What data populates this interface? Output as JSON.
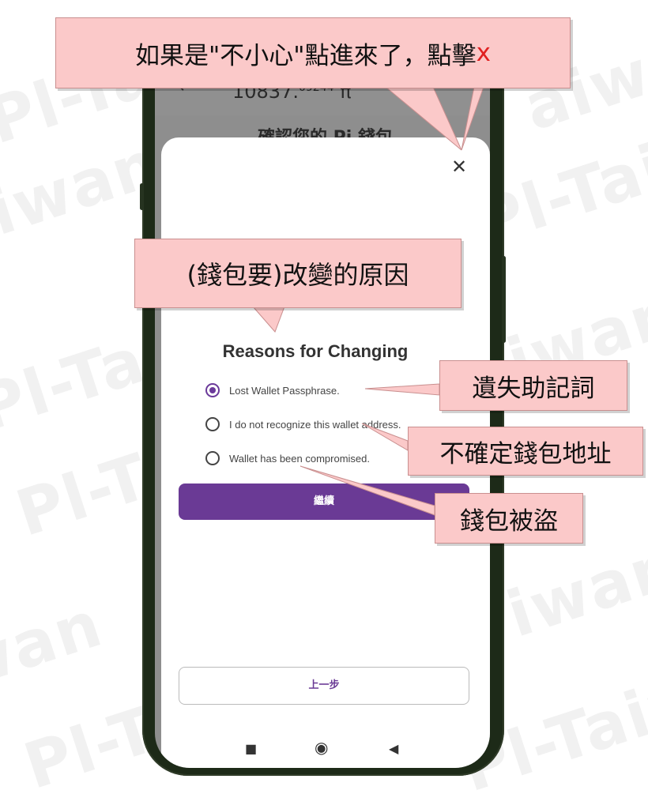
{
  "watermark": "PI-Taiwan",
  "watermark_fragments": [
    "Pl-Taiw",
    "aiwan",
    "Pl-Tai",
    "iwan",
    "Pl-Ta",
    "wan",
    "Pl-T",
    "Pl-Taiw",
    "Pl-"
  ],
  "app": {
    "balance": "10837.",
    "balance_decimals": "09244",
    "currency": "π",
    "screen_title_partial": "確認您的 Pi 錢包"
  },
  "sheet": {
    "title": "Reasons for Changing",
    "options": [
      {
        "label": "Lost Wallet Passphrase.",
        "selected": true
      },
      {
        "label": "I do not recognize this wallet address.",
        "selected": false
      },
      {
        "label": "Wallet has been compromised.",
        "selected": false
      }
    ],
    "continue_label": "繼續",
    "prev_label": "上一步"
  },
  "icons": {
    "back": "arrow-left-icon",
    "close": "close-icon",
    "nav_square": "square-icon",
    "nav_home": "circle-icon",
    "nav_back": "triangle-back-icon"
  },
  "callouts": {
    "top": "如果是\"不小心\"點進來了，點擊",
    "top_x": "x",
    "reason": "(錢包要)改變的原因",
    "lost": "遺失助記詞",
    "unsure": "不確定錢包地址",
    "stolen": "錢包被盜"
  },
  "colors": {
    "accent_purple": "#6a3a95",
    "callout_bg": "#fbc9c9",
    "callout_x": "#e02020",
    "phone_frame": "#1d2a18"
  }
}
